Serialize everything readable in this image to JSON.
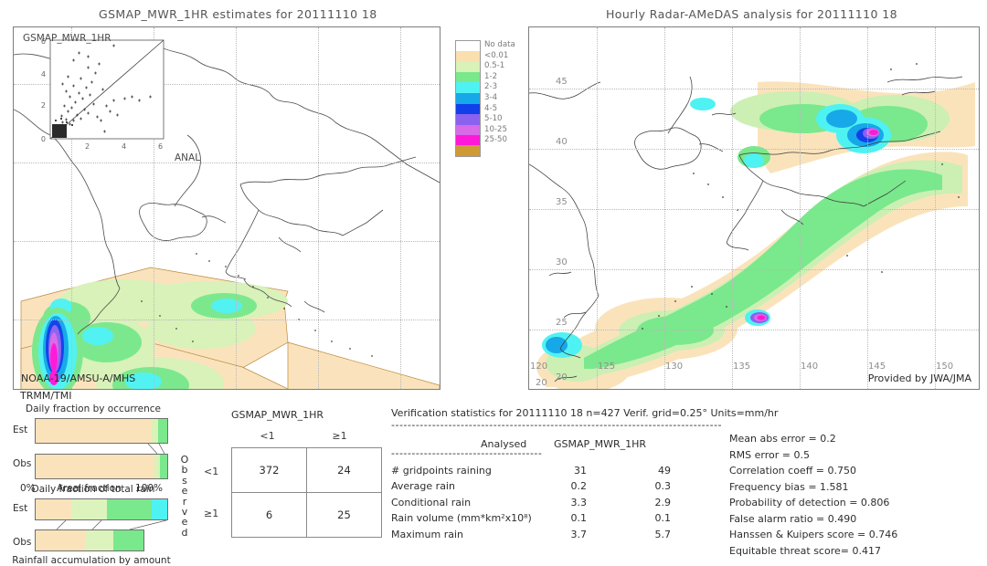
{
  "left_panel": {
    "title": "GSMAP_MWR_1HR estimates for 20111110 18",
    "corner_label": "GSMAP_MWR_1HR",
    "anal_label": "ANAL",
    "sensor_label_1": "NOAA-19/AMSU-A/MHS",
    "sensor_label_2": "TRMM/TMI",
    "inset": {
      "axis_ticks": [
        "0",
        "2",
        "4",
        "6"
      ],
      "max": 6
    }
  },
  "right_panel": {
    "title": "Hourly Radar-AMeDAS analysis for 20111110 18",
    "credit": "Provided by JWA/JMA",
    "x_ticks": [
      "120",
      "125",
      "130",
      "135",
      "140",
      "145",
      "150"
    ],
    "y_ticks": [
      "45",
      "40",
      "35",
      "30",
      "25",
      "20"
    ],
    "corner_tick": "20"
  },
  "legend": {
    "title": "",
    "entries": [
      {
        "label": "No data",
        "color": "#ffffff"
      },
      {
        "label": "<0.01",
        "color": "#fadfaf"
      },
      {
        "label": "0.5-1",
        "color": "#d8f2b8"
      },
      {
        "label": "1-2",
        "color": "#7ae88c"
      },
      {
        "label": "2-3",
        "color": "#4ff2f2"
      },
      {
        "label": "3-4",
        "color": "#16a8e8"
      },
      {
        "label": "4-5",
        "color": "#1140ea"
      },
      {
        "label": "5-10",
        "color": "#8a62f0"
      },
      {
        "label": "10-25",
        "color": "#d96ae8"
      },
      {
        "label": "25-50",
        "color": "#ff18d8"
      },
      {
        "label": "",
        "color": "#cf9a36"
      }
    ]
  },
  "occurrence_chart": {
    "title": "Daily fraction by occurrence",
    "row_labels": [
      "Est",
      "Obs"
    ],
    "x_left": "0%",
    "x_center": "Areal fraction",
    "x_right": "100%",
    "est_segments": [
      {
        "color": "#fae3bb",
        "pct": 88.0
      },
      {
        "color": "#d8f2b8",
        "pct": 5.0
      },
      {
        "color": "#7ae88c",
        "pct": 7.0
      }
    ],
    "obs_segments": [
      {
        "color": "#fae3bb",
        "pct": 90.5
      },
      {
        "color": "#d8f2b8",
        "pct": 4.0
      },
      {
        "color": "#7ae88c",
        "pct": 5.5
      }
    ]
  },
  "amount_chart": {
    "title": "Daily fraction of total rain",
    "row_labels": [
      "Est",
      "Obs"
    ],
    "caption": "Rainfall accumulation by amount",
    "est_segments": [
      {
        "color": "#fae3bb",
        "pct": 27.0
      },
      {
        "color": "#ddf3bd",
        "pct": 27.0
      },
      {
        "color": "#7ae88c",
        "pct": 34.0
      },
      {
        "color": "#4ff2f2",
        "pct": 12.0
      }
    ],
    "obs_segments": [
      {
        "color": "#fae3bb",
        "pct": 46.0
      },
      {
        "color": "#ddf3bd",
        "pct": 26.0
      },
      {
        "color": "#7ae88c",
        "pct": 28.0
      }
    ]
  },
  "contingency": {
    "title": "GSMAP_MWR_1HR",
    "col_headers": [
      "<1",
      "≥1"
    ],
    "row_axis_label": "Observed",
    "row_headers": [
      "<1",
      "≥1"
    ],
    "cells": [
      [
        "372",
        "24"
      ],
      [
        "6",
        "25"
      ]
    ]
  },
  "verification": {
    "header": "Verification statistics for 20111110 18  n=427  Verif. grid=0.25°  Units=mm/hr",
    "rule": "---------------------------------------------------------------------------------",
    "col_header_1": "Analysed",
    "col_header_2": "GSMAP_MWR_1HR",
    "sub_rule": "-------------------------------------",
    "rows": [
      {
        "label": "# gridpoints raining",
        "analysed": "31",
        "estimate": "49"
      },
      {
        "label": "Average rain",
        "analysed": "0.2",
        "estimate": "0.3"
      },
      {
        "label": "Conditional rain",
        "analysed": "3.3",
        "estimate": "2.9"
      },
      {
        "label": "Rain volume (mm*km²x10⁸)",
        "analysed": "0.1",
        "estimate": "0.1"
      },
      {
        "label": "Maximum rain",
        "analysed": "3.7",
        "estimate": "5.7"
      }
    ],
    "scores": [
      "Mean abs error = 0.2",
      "RMS error = 0.5",
      "Correlation coeff = 0.750",
      "Frequency bias = 1.581",
      "Probability of detection = 0.806",
      "False alarm ratio = 0.490",
      "Hanssen & Kuipers score = 0.746",
      "Equitable threat score= 0.417"
    ]
  }
}
